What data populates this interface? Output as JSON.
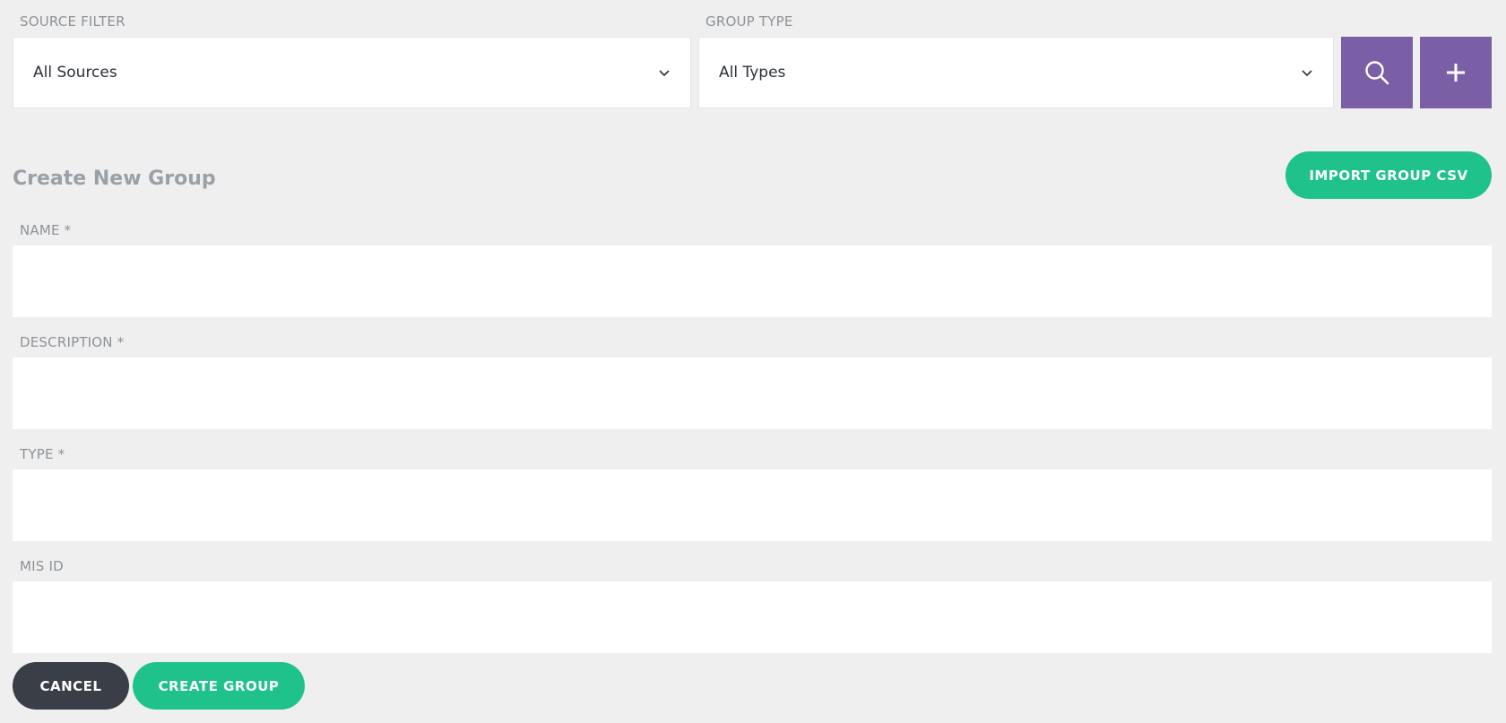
{
  "filters": {
    "source_label": "SOURCE FILTER",
    "source_value": "All Sources",
    "group_type_label": "GROUP TYPE",
    "group_type_value": "All Types",
    "search_icon": "search-icon",
    "add_icon": "plus-icon"
  },
  "form": {
    "title": "Create New Group",
    "import_button": "IMPORT GROUP CSV",
    "fields": [
      {
        "label": "NAME *",
        "value": ""
      },
      {
        "label": "DESCRIPTION *",
        "value": ""
      },
      {
        "label": "TYPE *",
        "value": ""
      },
      {
        "label": "MIS ID",
        "value": ""
      }
    ],
    "cancel_button": "CANCEL",
    "create_button": "CREATE GROUP"
  },
  "colors": {
    "background": "#efefef",
    "accent_purple": "#7a5ea6",
    "accent_green": "#1fc28a",
    "dark_button": "#3a3f47"
  }
}
